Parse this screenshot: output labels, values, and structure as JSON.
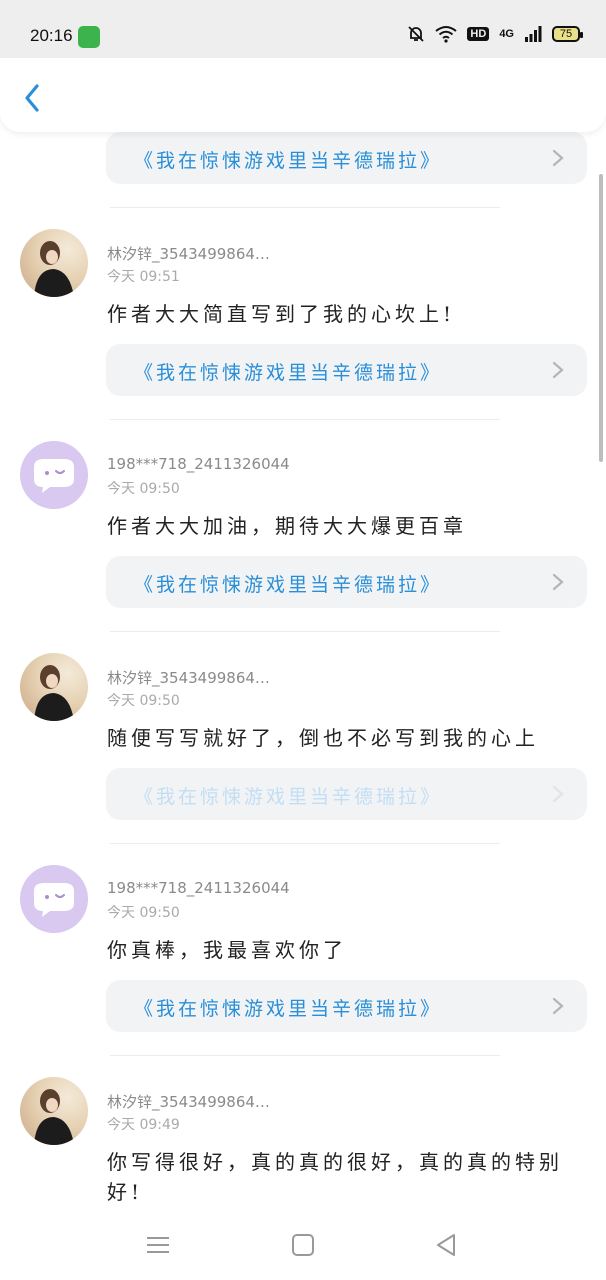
{
  "status_bar": {
    "time": "20:16",
    "network": "4G",
    "hd": "HD",
    "battery": "75"
  },
  "header": {
    "back_icon": "chevron-left-icon",
    "accent_color": "#2a8fd8"
  },
  "book_title": "《我在惊悚游戏里当辛德瑞拉》",
  "comments": [
    {
      "username": "林汐锌_3543499864…",
      "time": "今天 09:51",
      "text": "作者大大简直写到了我的心坎上!",
      "avatar": "photo"
    },
    {
      "username": "198***718_2411326044",
      "time": "今天 09:50",
      "text": "作者大大加油，期待大大爆更百章",
      "avatar": "chat-bubble"
    },
    {
      "username": "林汐锌_3543499864…",
      "time": "今天 09:50",
      "text": "随便写写就好了，倒也不必写到我的心上",
      "avatar": "photo"
    },
    {
      "username": "198***718_2411326044",
      "time": "今天 09:50",
      "text": "你真棒，我最喜欢你了",
      "avatar": "chat-bubble"
    },
    {
      "username": "林汐锌_3543499864…",
      "time": "今天 09:49",
      "text": "你写得很好，真的真的很好，真的真的特别好!",
      "avatar": "photo"
    }
  ]
}
